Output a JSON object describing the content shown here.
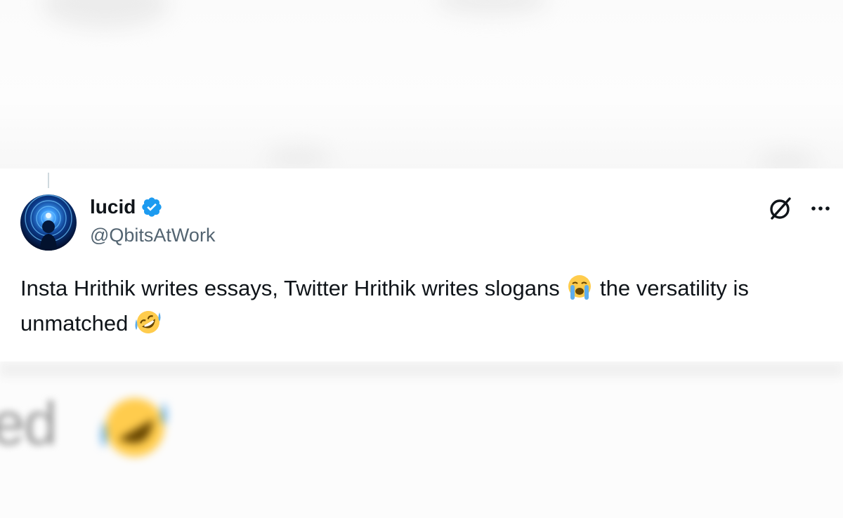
{
  "tweet": {
    "author_name": "lucid",
    "handle": "@QbitsAtWork",
    "text_part1": "Insta Hrithik writes essays, Twitter Hrithik writes slogans",
    "text_part2": "the versatility is unmatched",
    "emoji_1": "crying-face-emoji",
    "emoji_2": "rolling-on-floor-laughing-emoji"
  },
  "background_blurred_text": "ed",
  "colors": {
    "verified_blue": "#1d9bf0",
    "text_primary": "#0f1419",
    "text_secondary": "#536471"
  }
}
